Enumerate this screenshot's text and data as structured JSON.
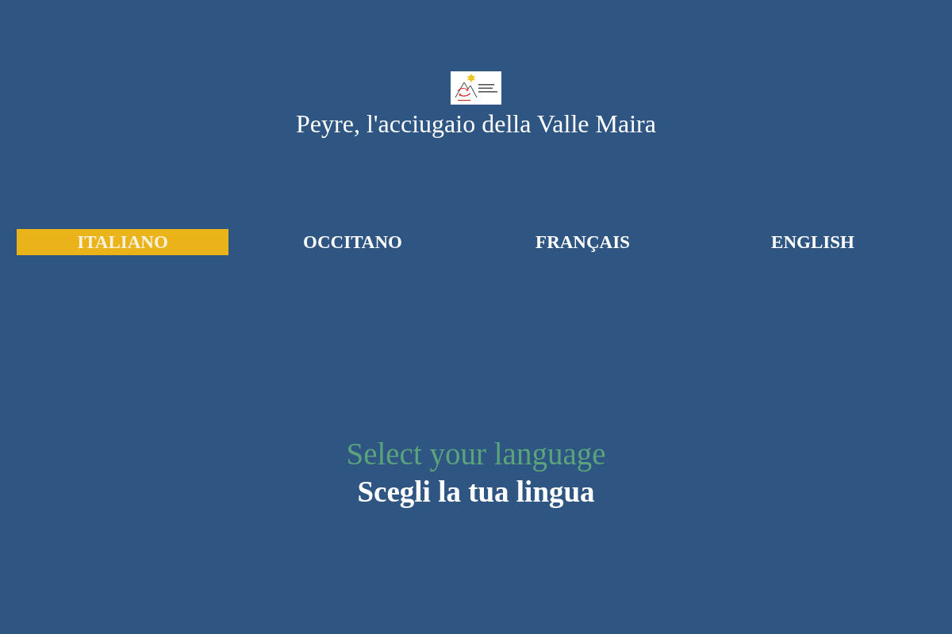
{
  "title": "Peyre, l'acciugaio della Valle Maira",
  "languages": [
    {
      "label": "ITALIANO",
      "selected": true
    },
    {
      "label": "OCCITANO",
      "selected": false
    },
    {
      "label": "FRANÇAIS",
      "selected": false
    },
    {
      "label": "ENGLISH",
      "selected": false
    }
  ],
  "prompt": {
    "primary": "Select your language",
    "secondary": "Scegli la tua lingua"
  }
}
